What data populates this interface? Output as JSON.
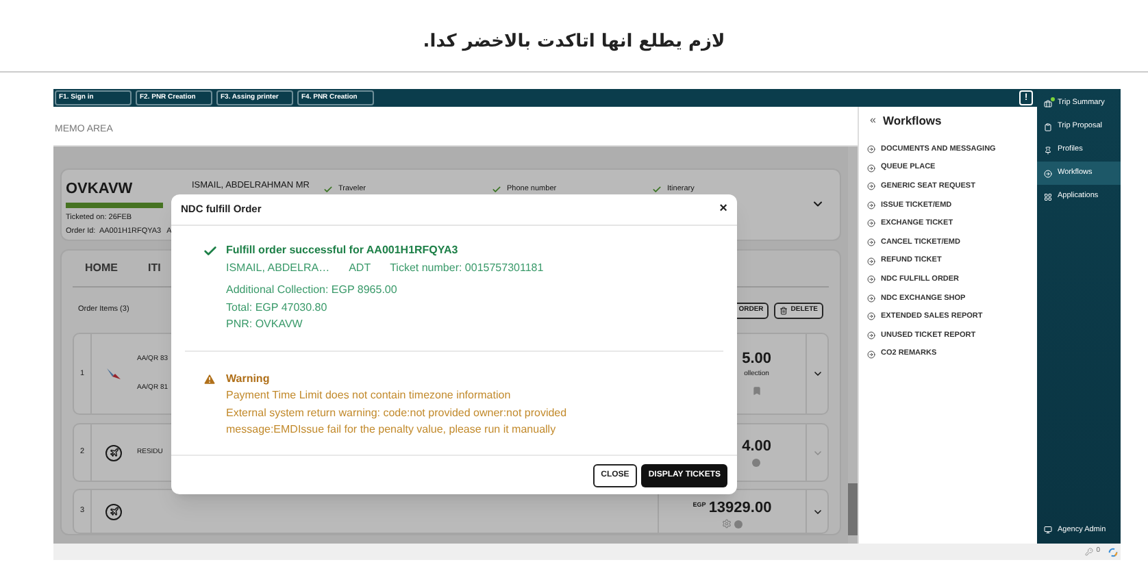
{
  "caption": "لازم يطلع انها اتاكدت بالاخضر كدا.",
  "toolbar": {
    "function_keys": [
      {
        "label": "F1. Sign in"
      },
      {
        "label": "F2. PNR Creation"
      },
      {
        "label": "F3. Assing printer"
      },
      {
        "label": "F4. PNR Creation"
      }
    ],
    "alert_button": "!"
  },
  "memo_area": {
    "label": "MEMO AREA"
  },
  "booking_card": {
    "pnr": "OVKAVW",
    "ticketed_on": "Ticketed on: 26FEB",
    "order_id": "Order Id:  AA001H1RFQYA3",
    "order_id_more": "A",
    "passenger": "ISMAIL, ABDELRAHMAN MR",
    "checks": [
      {
        "label": "Traveler",
        "checked": true
      },
      {
        "label": "Phone number",
        "checked": true
      },
      {
        "label": "Itinerary",
        "checked": true
      }
    ]
  },
  "order_panel": {
    "tabs": [
      {
        "label": "HOME"
      },
      {
        "label": "ITI"
      }
    ],
    "items_label": "Order Items (3)",
    "buttons": [
      "ORDER",
      "DELETE"
    ],
    "rows": [
      {
        "number": "1",
        "kind": "flight",
        "lines": [
          "AA/QR 83",
          "AA/QR 81"
        ],
        "price": "5.00",
        "note": "ollection"
      },
      {
        "number": "2",
        "kind": "residual",
        "lines": [
          "RESIDU"
        ],
        "price": "4.00"
      },
      {
        "number": "3",
        "kind": "service",
        "lines": [],
        "currency": "EGP",
        "price": "13929.00"
      }
    ]
  },
  "modal": {
    "title": "NDC fulfill Order",
    "close": "×",
    "messages": [
      {
        "kind": "success",
        "title": "Fulfill order successful for AA001H1RFQYA3",
        "fields": [
          "ISMAIL, ABDELRA…",
          "ADT",
          "Ticket number: 0015757301181"
        ],
        "lines": [
          "Additional Collection: EGP 8965.00",
          "Total: EGP 47030.80",
          "PNR: OVKAVW"
        ]
      },
      {
        "kind": "warning",
        "title": "Warning",
        "lines": [
          "Payment Time Limit does not contain timezone information",
          "External system return warning: code:not provided owner:not provided",
          "message:EMDIssue fail for the penalty value, please run it manually"
        ]
      }
    ],
    "buttons": [
      {
        "label": "CLOSE",
        "kind": "secondary"
      },
      {
        "label": "DISPLAY TICKETS",
        "kind": "primary"
      }
    ]
  },
  "workflows": {
    "collapse": "«",
    "title": "Workflows",
    "items": [
      "DOCUMENTS AND MESSAGING",
      "QUEUE PLACE",
      "GENERIC SEAT REQUEST",
      "ISSUE TICKET/EMD",
      "EXCHANGE TICKET",
      "CANCEL TICKET/EMD",
      "REFUND TICKET",
      "NDC FULFILL ORDER",
      "NDC EXCHANGE SHOP",
      "EXTENDED SALES REPORT",
      "UNUSED TICKET REPORT",
      "CO2 REMARKS"
    ]
  },
  "nav": {
    "items": [
      {
        "label": "Trip Summary",
        "selected": false,
        "alert": true
      },
      {
        "label": "Trip Proposal",
        "selected": false,
        "alert": false
      },
      {
        "label": "Profiles",
        "selected": false,
        "alert": false
      },
      {
        "label": "Workflows",
        "selected": true,
        "alert": false
      },
      {
        "label": "Applications",
        "selected": false,
        "alert": false
      }
    ],
    "footer": "Agency Admin"
  },
  "status_bar": {
    "count": "0"
  }
}
